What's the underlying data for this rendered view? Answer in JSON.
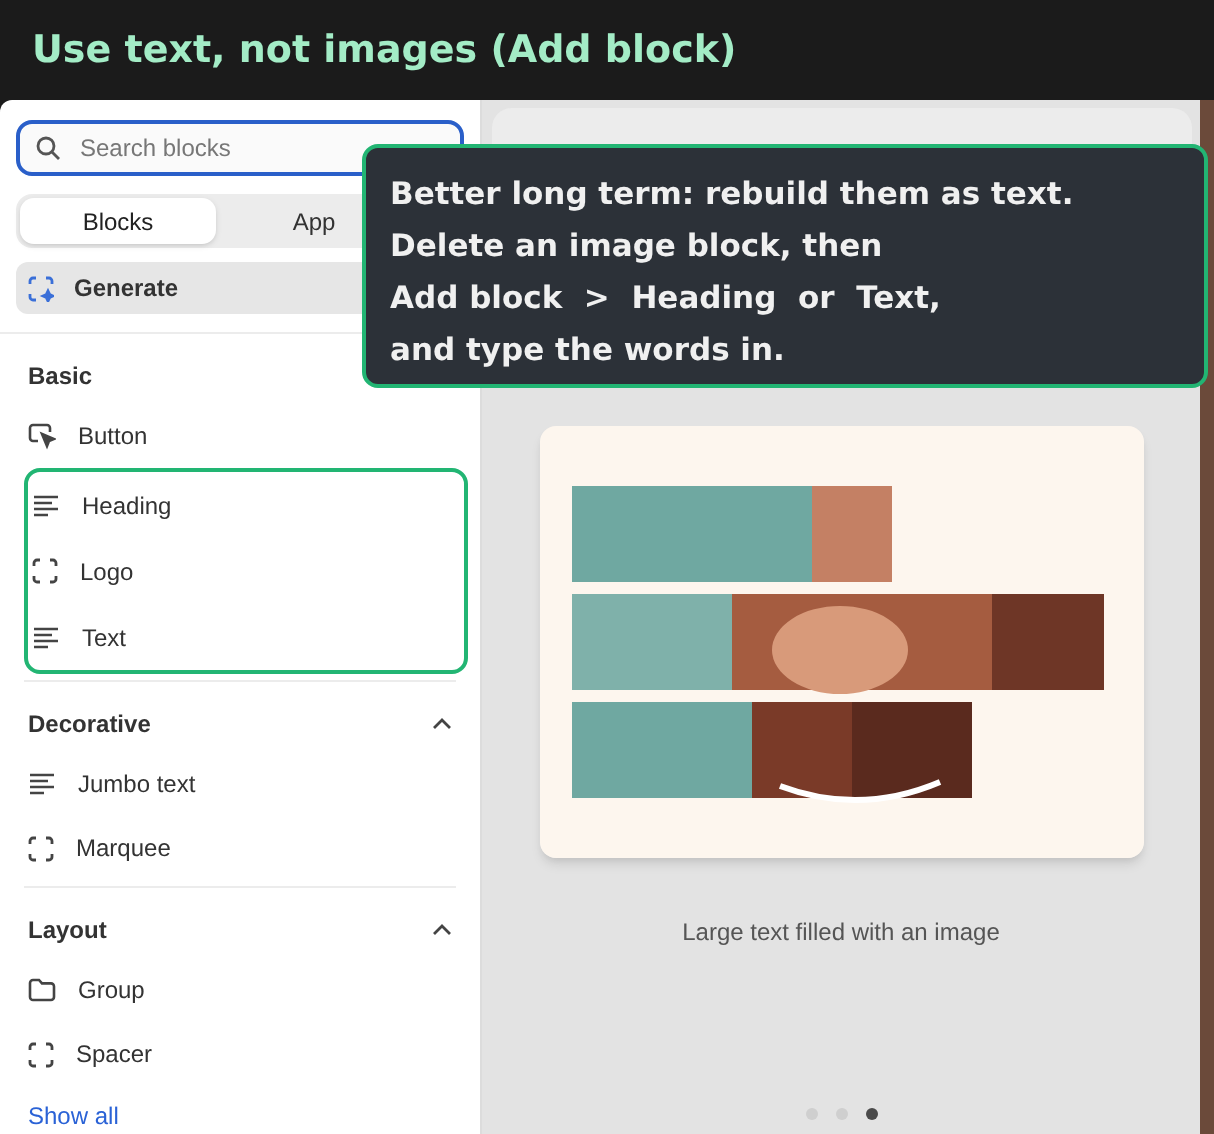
{
  "banner": {
    "title": "Use text, not images (Add block)"
  },
  "sidebar": {
    "search": {
      "placeholder": "Search blocks"
    },
    "tabs": [
      {
        "label": "Blocks",
        "selected": true
      },
      {
        "label": "App",
        "selected": false
      }
    ],
    "generate": {
      "label": "Generate"
    },
    "sections": [
      {
        "title": "Basic",
        "items": [
          {
            "label": "Button",
            "kind": "cursor",
            "highlighted": false
          },
          {
            "label": "Heading",
            "kind": "lines",
            "highlighted": true
          },
          {
            "label": "Logo",
            "kind": "frame",
            "highlighted": true
          },
          {
            "label": "Text",
            "kind": "lines",
            "highlighted": true
          }
        ]
      },
      {
        "title": "Decorative",
        "expanded": true,
        "items": [
          {
            "label": "Jumbo text",
            "kind": "lines",
            "highlighted": false
          },
          {
            "label": "Marquee",
            "kind": "frame",
            "highlighted": false
          }
        ]
      },
      {
        "title": "Layout",
        "expanded": true,
        "items": [
          {
            "label": "Group",
            "kind": "folder",
            "highlighted": false
          },
          {
            "label": "Spacer",
            "kind": "frame",
            "highlighted": false
          }
        ]
      }
    ],
    "show_all": "Show all"
  },
  "preview": {
    "caption": "Large text filled with an image",
    "dots": [
      {
        "selected": false
      },
      {
        "selected": false
      },
      {
        "selected": true
      }
    ]
  },
  "callout": {
    "lines": [
      "Better long term: rebuild them as text.",
      "Delete an image block, then",
      "Add block  >  Heading  or  Text,",
      "and type the words in."
    ]
  }
}
